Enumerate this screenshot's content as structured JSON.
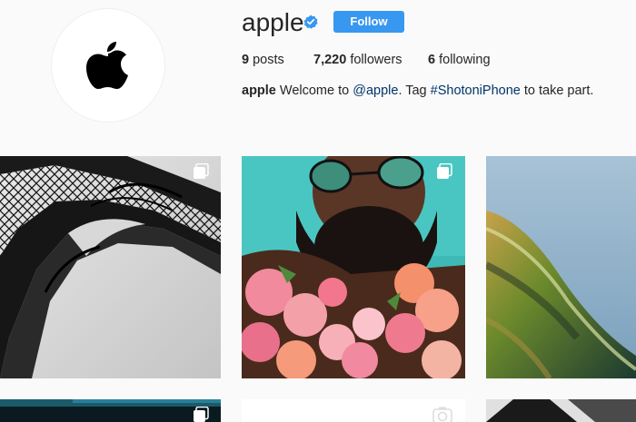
{
  "profile": {
    "username": "apple",
    "verified_icon": "verified-badge-icon",
    "follow_label": "Follow",
    "posts_count": "9",
    "posts_label": "posts",
    "followers_count": "7,220",
    "followers_label": "followers",
    "following_count": "6",
    "following_label": "following",
    "bio_name": "apple",
    "bio_text_1": "Welcome to",
    "bio_mention": "@apple",
    "bio_text_2": ". Tag",
    "bio_hashtag": "#ShotoniPhone",
    "bio_text_3": "to take part."
  },
  "colors": {
    "follow_button": "#3897f0",
    "link": "#003569",
    "verified": "#3897f0",
    "background": "#fafafa"
  },
  "icons": {
    "avatar": "apple-logo-icon",
    "multi_post": "multiple-photos-icon",
    "video_post": "video-camera-icon"
  }
}
